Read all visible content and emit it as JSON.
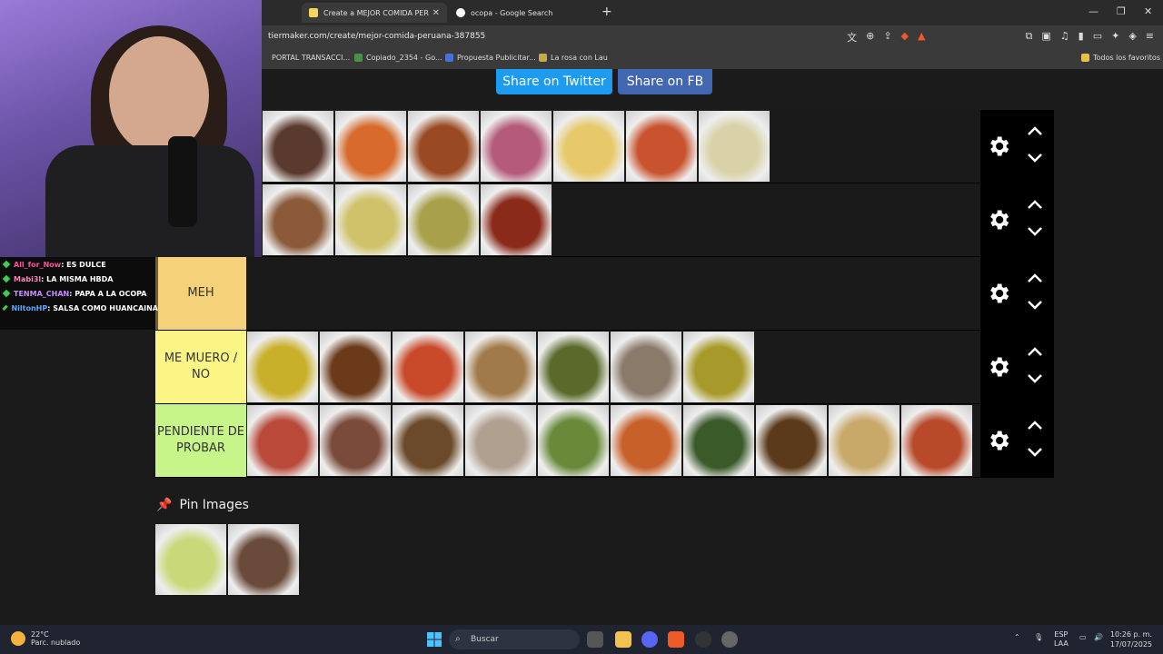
{
  "browser": {
    "tabs": [
      {
        "title": "Create a MEJOR COMIDA PERUANA",
        "active": true
      },
      {
        "title": "ocopa - Google Search",
        "active": false
      }
    ],
    "new_tab_icon": "plus-icon",
    "url": "tiermaker.com/create/mejor-comida-peruana-387855",
    "bookmarks": [
      "PORTAL TRANSACCI...",
      "Copiado_2354 - Go...",
      "Propuesta Publicitar...",
      "La rosa con Lau"
    ],
    "all_bookmarks": "Todos los favoritos"
  },
  "share": {
    "twitter": "Share on Twitter",
    "facebook": "Share on FB"
  },
  "tiers": [
    {
      "label": "",
      "color": "#1a1a1a",
      "items": [
        "#5a3a2e",
        "#d76a2c",
        "#9a4a22",
        "#b45a7a",
        "#e7c96a",
        "#c9532e",
        "#d9d2a8"
      ]
    },
    {
      "label": "",
      "color": "#1a1a1a",
      "items": [
        "#8a5a3a",
        "#cfc26a",
        "#a8a04a",
        "#8a2a1a"
      ]
    },
    {
      "label": "MEH",
      "color": "#f5d27a",
      "items": []
    },
    {
      "label": "ME MUERO / NO",
      "color": "#fbf585",
      "items": [
        "#c9b02a",
        "#6a3a1a",
        "#c84a2a",
        "#a07a4a",
        "#5a6a2a",
        "#8a7a6a",
        "#a89a2a"
      ]
    },
    {
      "label": "PENDIENTE DE PROBAR",
      "color": "#c8f58a",
      "items": [
        "#b94a3a",
        "#7a4a3a",
        "#6a4a2a",
        "#b0a090",
        "#6a8a3a",
        "#c8602a",
        "#3a5a2a",
        "#5a3a1a",
        "#c9a96a",
        "#b84a2a"
      ]
    }
  ],
  "pin": {
    "heading": "Pin Images",
    "items": [
      "#c9d97a",
      "#6a4a3a"
    ]
  },
  "chat": [
    {
      "user": "All_for_Now",
      "color": "#ff4fa0",
      "msg": ": ES DULCE"
    },
    {
      "user": "Mabi3l",
      "color": "#ff7fbf",
      "msg": ": LA MISMA HBDA"
    },
    {
      "user": "TENMA_CHAN",
      "color": "#c78cff",
      "msg": ": PAPA A LA OCOPA"
    },
    {
      "user": "NiltonHP",
      "color": "#5aa9ff",
      "msg": ": SALSA COMO HUANCAINA"
    }
  ],
  "taskbar": {
    "temp": "22°C",
    "weather": "Parc. nublado",
    "search": "Buscar",
    "lang1": "ESP",
    "lang2": "LAA",
    "time": "10:26 p. m.",
    "date": "17/07/2025"
  }
}
